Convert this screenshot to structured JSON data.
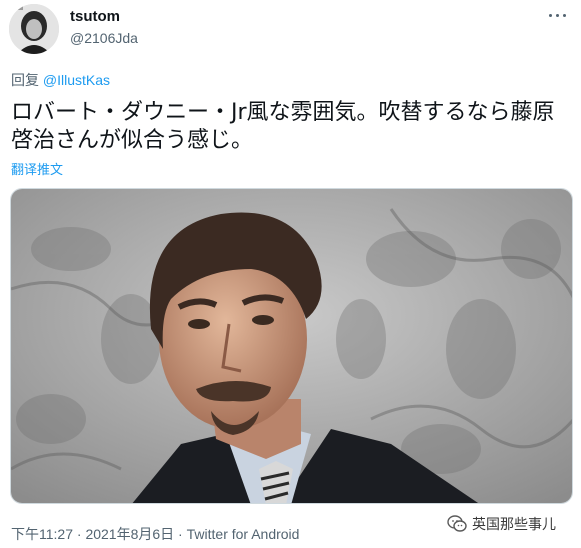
{
  "user": {
    "display_name": "tsutom",
    "handle": "@2106Jda"
  },
  "reply": {
    "prefix": "回复 ",
    "mention": "@IllustKas"
  },
  "tweet": {
    "text": "ロバート・ダウニー・Jr風な雰囲気。吹替するなら藤原啓治さんが似合う感じ。",
    "translate_label": "翻译推文"
  },
  "meta": {
    "time": "下午11:27",
    "separator": " · ",
    "date": "2021年8月6日",
    "source": "Twitter for Android"
  },
  "watermark": {
    "text": "英国那些事儿"
  },
  "icons": {
    "more": "more-dots-icon",
    "watermark": "wechat-logo-icon"
  },
  "colors": {
    "accent": "#1d9bf0",
    "secondary_text": "#536471",
    "primary_text": "#0f1419"
  }
}
